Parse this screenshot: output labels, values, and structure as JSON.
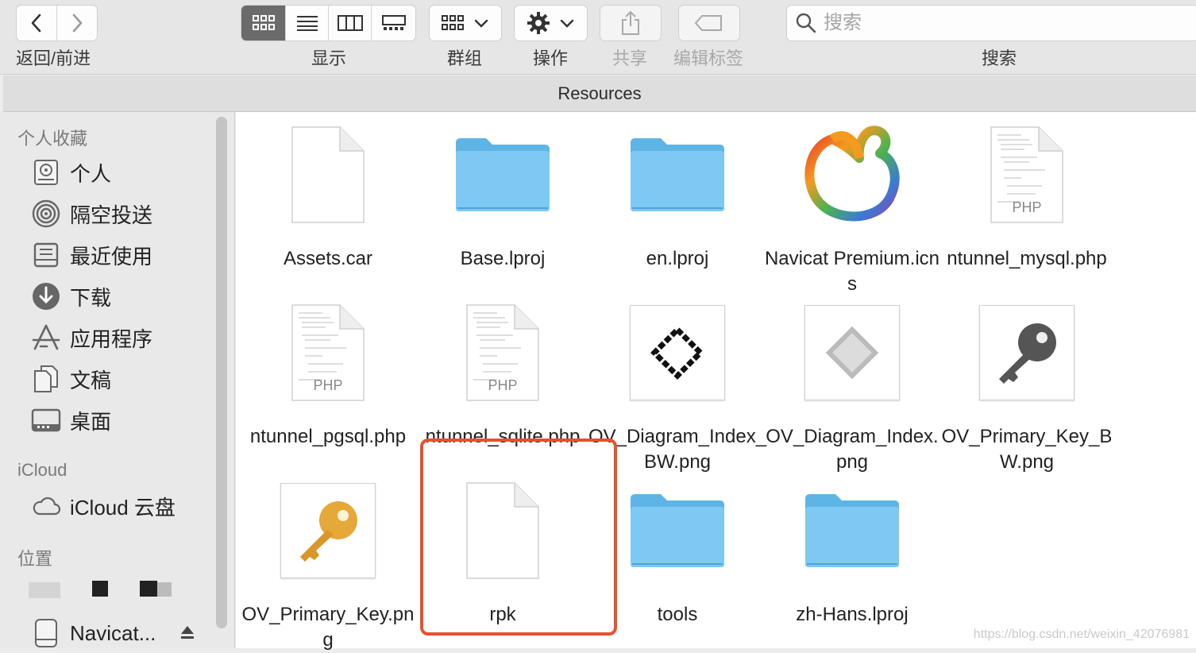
{
  "toolbar": {
    "back_forward_label": "返回/前进",
    "view_label": "显示",
    "group_label": "群组",
    "action_label": "操作",
    "share_label": "共享",
    "tags_label": "编辑标签",
    "search_label": "搜索",
    "search_placeholder": "搜索"
  },
  "window": {
    "title": "Resources"
  },
  "sidebar": {
    "favorites_header": "个人收藏",
    "favorites": [
      {
        "label": "个人",
        "icon": "home-icon"
      },
      {
        "label": "隔空投送",
        "icon": "airdrop-icon"
      },
      {
        "label": "最近使用",
        "icon": "recents-icon"
      },
      {
        "label": "下载",
        "icon": "downloads-icon"
      },
      {
        "label": "应用程序",
        "icon": "applications-icon"
      },
      {
        "label": "文稿",
        "icon": "documents-icon"
      },
      {
        "label": "桌面",
        "icon": "desktop-icon"
      }
    ],
    "icloud_header": "iCloud",
    "icloud_items": [
      {
        "label": "iCloud 云盘",
        "icon": "cloud-icon"
      }
    ],
    "locations_header": "位置",
    "locations": [
      {
        "label": "Navicat...",
        "icon": "disk-icon"
      }
    ]
  },
  "files": [
    {
      "name": "Assets.car",
      "kind": "document"
    },
    {
      "name": "Base.lproj",
      "kind": "folder"
    },
    {
      "name": "en.lproj",
      "kind": "folder"
    },
    {
      "name": "Navicat Premium.icns",
      "kind": "navicat"
    },
    {
      "name": "ntunnel_mysql.php",
      "kind": "php"
    },
    {
      "name": "ntunnel_pgsql.php",
      "kind": "php"
    },
    {
      "name": "ntunnel_sqlite.php",
      "kind": "php"
    },
    {
      "name": "OV_Diagram_Index_BW.png",
      "kind": "diamond-bw"
    },
    {
      "name": "OV_Diagram_Index.png",
      "kind": "diamond-gray"
    },
    {
      "name": "OV_Primary_Key_BW.png",
      "kind": "key-bw"
    },
    {
      "name": "OV_Primary_Key.png",
      "kind": "key-gold"
    },
    {
      "name": "rpk",
      "kind": "document"
    },
    {
      "name": "tools",
      "kind": "folder"
    },
    {
      "name": "zh-Hans.lproj",
      "kind": "folder"
    }
  ],
  "php_badge": "PHP",
  "highlighted_file": "rpk",
  "colors": {
    "highlight": "#e8502f",
    "folder": "#6cc0f0"
  },
  "watermark": "https://blog.csdn.net/weixin_42076981"
}
